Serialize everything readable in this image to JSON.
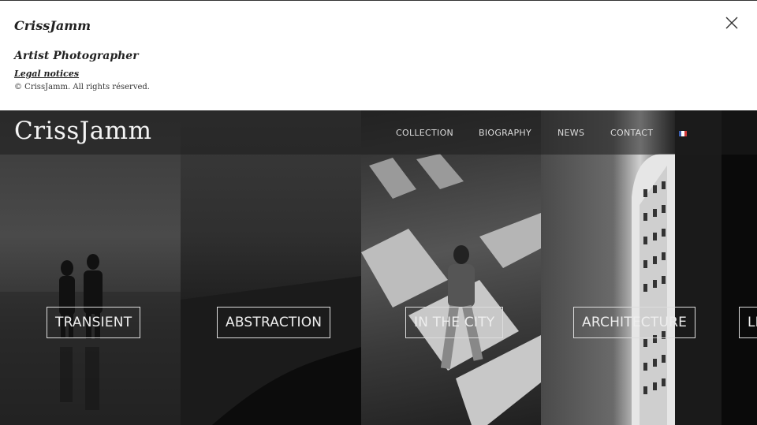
{
  "info": {
    "brand": "CrissJamm",
    "role": "Artist Photographer",
    "legal_label": "Legal notices",
    "copyright": "© CrissJamm. All rights réserved."
  },
  "header": {
    "logo": "CrissJamm",
    "nav": [
      "COLLECTION",
      "BIOGRAPHY",
      "NEWS",
      "CONTACT"
    ],
    "flag_colors": [
      "#3c5fb0",
      "#ffffff",
      "#d23a3a"
    ]
  },
  "gallery": {
    "panels": [
      {
        "label": "TRANSIENT"
      },
      {
        "label": "ABSTRACTION"
      },
      {
        "label": "IN THE CITY"
      },
      {
        "label": "ARCHITECTURE"
      },
      {
        "label": "LI"
      }
    ]
  }
}
